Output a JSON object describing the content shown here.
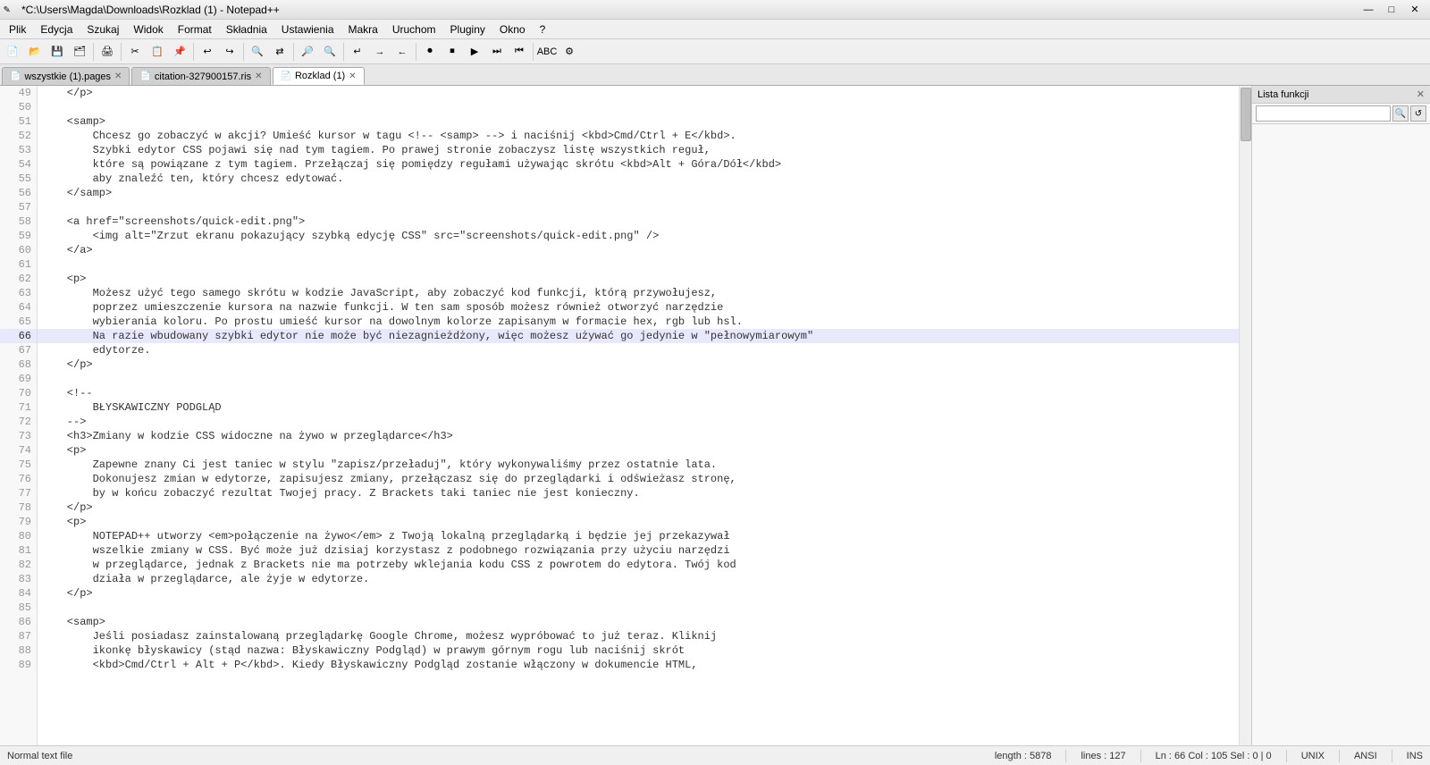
{
  "titlebar": {
    "title": "*C:\\Users\\Magda\\Downloads\\Rozklad (1) - Notepad++",
    "app_icon": "✎",
    "minimize_label": "—",
    "maximize_label": "□",
    "close_label": "✕"
  },
  "menubar": {
    "items": [
      "Plik",
      "Edycja",
      "Szukaj",
      "Widok",
      "Format",
      "Składnia",
      "Ustawienia",
      "Makra",
      "Uruchom",
      "Pluginy",
      "Okno",
      "?"
    ]
  },
  "tabs": [
    {
      "label": "wszystkie (1).pages",
      "active": false,
      "icon": "📄"
    },
    {
      "label": "citation-327900157.ris",
      "active": false,
      "icon": "📄"
    },
    {
      "label": "Rozklad (1)",
      "active": true,
      "icon": "📄"
    }
  ],
  "function_list": {
    "header": "Lista funkcji",
    "close": "✕",
    "search_placeholder": "",
    "btn1": "🔍",
    "btn2": "↺"
  },
  "statusbar": {
    "left": {
      "file_type": "Normal text file"
    },
    "right": {
      "length": "length : 5878",
      "lines": "lines : 127",
      "position": "Ln : 66   Col : 105   Sel : 0 | 0",
      "encoding_unix": "UNIX",
      "encoding": "ANSI",
      "ins": "INS"
    }
  },
  "lines": [
    {
      "num": 49,
      "content": "    </p>",
      "highlighted": false
    },
    {
      "num": 50,
      "content": "",
      "highlighted": false
    },
    {
      "num": 51,
      "content": "    <samp>",
      "highlighted": false
    },
    {
      "num": 52,
      "content": "        Chcesz go zobaczyć w akcji? Umieść kursor w tagu <!-- <samp> --> i naciśnij <kbd>Cmd/Ctrl + E</kbd>.",
      "highlighted": false
    },
    {
      "num": 53,
      "content": "        Szybki edytor CSS pojawi się nad tym tagiem. Po prawej stronie zobaczysz listę wszystkich reguł,",
      "highlighted": false
    },
    {
      "num": 54,
      "content": "        które są powiązane z tym tagiem. Przełączaj się pomiędzy regułami używając skrótu <kbd>Alt + Góra/Dół</kbd>",
      "highlighted": false
    },
    {
      "num": 55,
      "content": "        aby znaleźć ten, który chcesz edytować.",
      "highlighted": false
    },
    {
      "num": 56,
      "content": "    </samp>",
      "highlighted": false
    },
    {
      "num": 57,
      "content": "",
      "highlighted": false
    },
    {
      "num": 58,
      "content": "    <a href=\"screenshots/quick-edit.png\">",
      "highlighted": false
    },
    {
      "num": 59,
      "content": "        <img alt=\"Zrzut ekranu pokazujący szybką edycję CSS\" src=\"screenshots/quick-edit.png\" />",
      "highlighted": false
    },
    {
      "num": 60,
      "content": "    </a>",
      "highlighted": false
    },
    {
      "num": 61,
      "content": "",
      "highlighted": false
    },
    {
      "num": 62,
      "content": "    <p>",
      "highlighted": false
    },
    {
      "num": 63,
      "content": "        Możesz użyć tego samego skrótu w kodzie JavaScript, aby zobaczyć kod funkcji, którą przywołujesz,",
      "highlighted": false
    },
    {
      "num": 64,
      "content": "        poprzez umieszczenie kursora na nazwie funkcji. W ten sam sposób możesz również otworzyć narzędzie",
      "highlighted": false
    },
    {
      "num": 65,
      "content": "        wybierania koloru. Po prostu umieść kursor na dowolnym kolorze zapisanym w formacie hex, rgb lub hsl.",
      "highlighted": false
    },
    {
      "num": 66,
      "content": "        Na razie wbudowany szybki edytor nie może być niezagnieżdżony, więc możesz używać go jedynie w \"pełnowymiarowym\"",
      "highlighted": true
    },
    {
      "num": 67,
      "content": "        edytorze.",
      "highlighted": false
    },
    {
      "num": 68,
      "content": "    </p>",
      "highlighted": false
    },
    {
      "num": 69,
      "content": "",
      "highlighted": false
    },
    {
      "num": 70,
      "content": "    <!--",
      "highlighted": false
    },
    {
      "num": 71,
      "content": "        BŁYSKAWICZNY PODGLĄD",
      "highlighted": false
    },
    {
      "num": 72,
      "content": "    -->",
      "highlighted": false
    },
    {
      "num": 73,
      "content": "    <h3>Zmiany w kodzie CSS widoczne na żywo w przeglądarce</h3>",
      "highlighted": false
    },
    {
      "num": 74,
      "content": "    <p>",
      "highlighted": false
    },
    {
      "num": 75,
      "content": "        Zapewne znany Ci jest taniec w stylu \"zapisz/przeładuj\", który wykonywaliśmy przez ostatnie lata.",
      "highlighted": false
    },
    {
      "num": 76,
      "content": "        Dokonujesz zmian w edytorze, zapisujesz zmiany, przełączasz się do przeglądarki i odświeżasz stronę,",
      "highlighted": false
    },
    {
      "num": 77,
      "content": "        by w końcu zobaczyć rezultat Twojej pracy. Z Brackets taki taniec nie jest konieczny.",
      "highlighted": false
    },
    {
      "num": 78,
      "content": "    </p>",
      "highlighted": false
    },
    {
      "num": 79,
      "content": "    <p>",
      "highlighted": false
    },
    {
      "num": 80,
      "content": "        NOTEPAD++ utworzy <em>połączenie na żywo</em> z Twoją lokalną przeglądarką i będzie jej przekazywał",
      "highlighted": false
    },
    {
      "num": 81,
      "content": "        wszelkie zmiany w CSS. Być może już dzisiaj korzystasz z podobnego rozwiązania przy użyciu narzędzi",
      "highlighted": false
    },
    {
      "num": 82,
      "content": "        w przeglądarce, jednak z Brackets nie ma potrzeby wklejania kodu CSS z powrotem do edytora. Twój kod",
      "highlighted": false
    },
    {
      "num": 83,
      "content": "        działa w przeglądarce, ale żyje w edytorze.",
      "highlighted": false
    },
    {
      "num": 84,
      "content": "    </p>",
      "highlighted": false
    },
    {
      "num": 85,
      "content": "",
      "highlighted": false
    },
    {
      "num": 86,
      "content": "    <samp>",
      "highlighted": false
    },
    {
      "num": 87,
      "content": "        Jeśli posiadasz zainstalowaną przeglądarkę Google Chrome, możesz wypróbować to już teraz. Kliknij",
      "highlighted": false
    },
    {
      "num": 88,
      "content": "        ikonkę błyskawicy (stąd nazwa: Błyskawiczny Podgląd) w prawym górnym rogu lub naciśnij skrót",
      "highlighted": false
    },
    {
      "num": 89,
      "content": "        <kbd>Cmd/Ctrl + Alt + P</kbd>. Kiedy Błyskawiczny Podgląd zostanie włączony w dokumencie HTML,",
      "highlighted": false
    }
  ]
}
